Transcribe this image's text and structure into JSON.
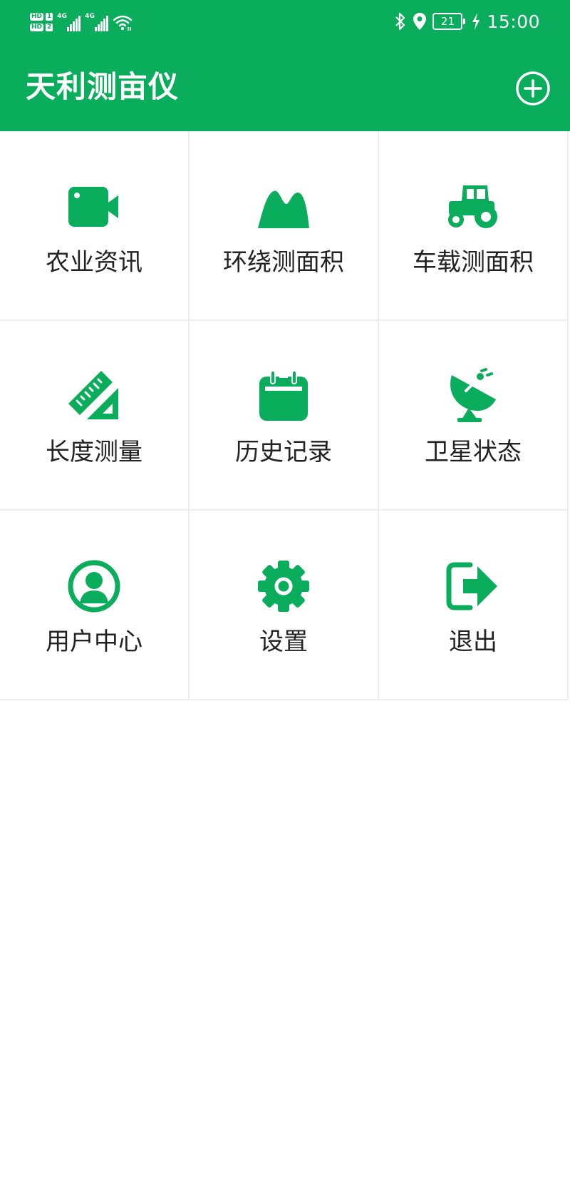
{
  "status_bar": {
    "sim1_badge": "HD",
    "sim1_number": "1",
    "sim2_badge": "HD",
    "sim2_number": "2",
    "network1": "4G",
    "network2": "4G",
    "battery_level": "21",
    "time": "15:00"
  },
  "app_bar": {
    "title": "天利测亩仪",
    "add_icon": "plus-circle-icon"
  },
  "menu": {
    "items": [
      {
        "label": "农业资讯",
        "icon": "video-camera-icon"
      },
      {
        "label": "环绕测面积",
        "icon": "mountain-icon"
      },
      {
        "label": "车载测面积",
        "icon": "tractor-icon"
      },
      {
        "label": "长度测量",
        "icon": "ruler-icon"
      },
      {
        "label": "历史记录",
        "icon": "calendar-icon"
      },
      {
        "label": "卫星状态",
        "icon": "satellite-dish-icon"
      },
      {
        "label": "用户中心",
        "icon": "user-circle-icon"
      },
      {
        "label": "设置",
        "icon": "gear-icon"
      },
      {
        "label": "退出",
        "icon": "exit-icon"
      }
    ]
  },
  "colors": {
    "brand_green": "#0aad5b",
    "text_dark": "#222222",
    "divider": "#eeeeee"
  }
}
